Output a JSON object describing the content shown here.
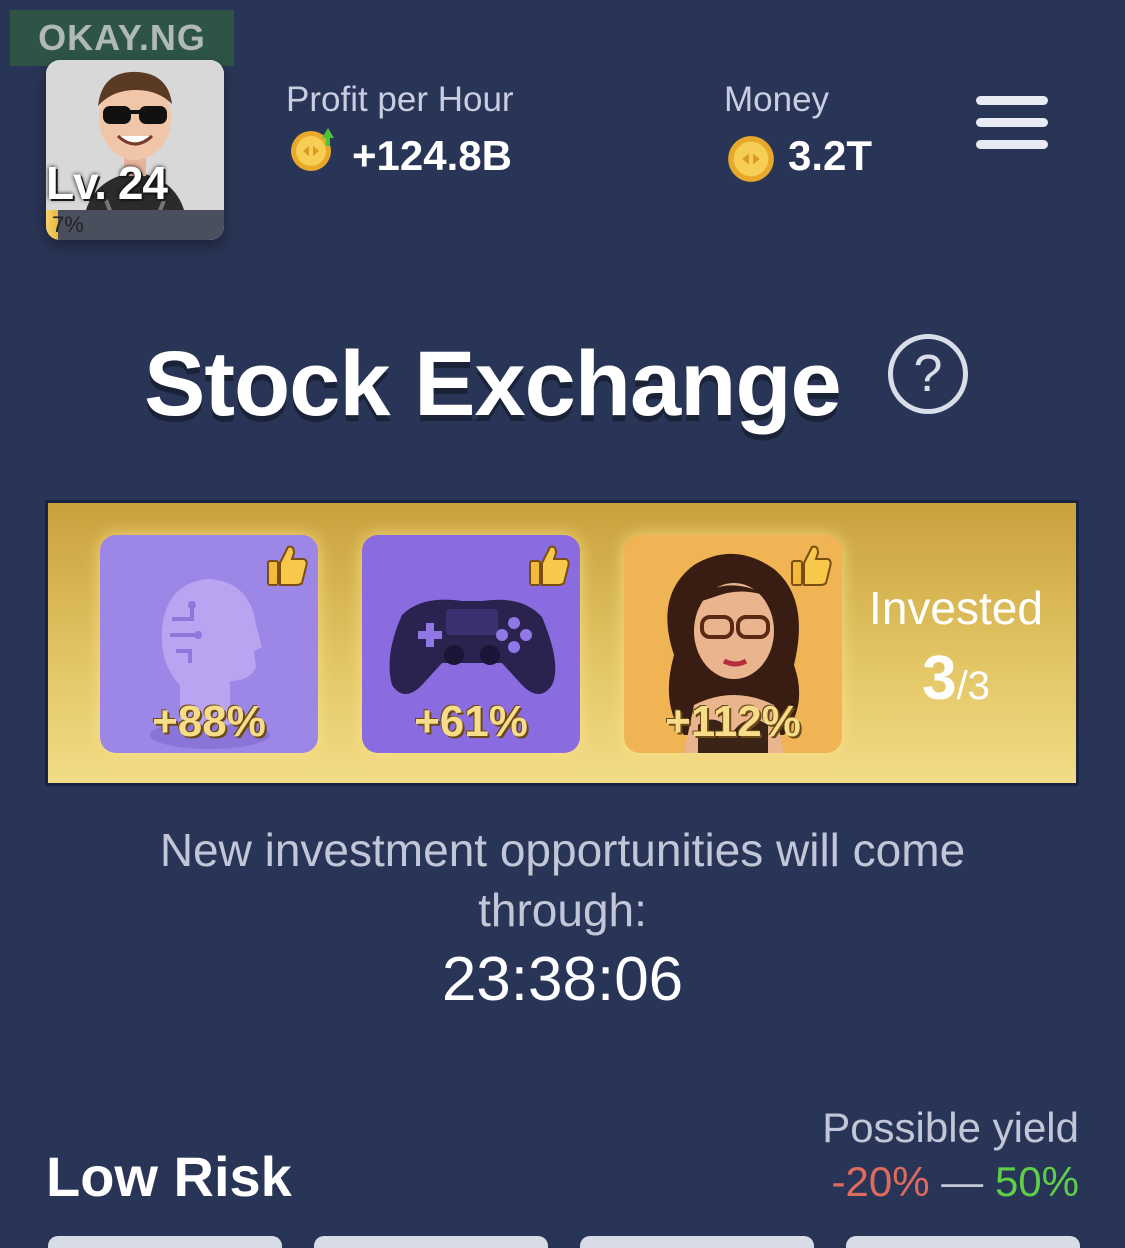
{
  "watermark": "OKAY.NG",
  "player": {
    "level": "Lv. 24",
    "level_progress": "7%",
    "level_progress_fraction": 0.07
  },
  "stats": {
    "profit_label": "Profit per Hour",
    "profit_value": "+124.8B",
    "money_label": "Money",
    "money_value": "3.2T"
  },
  "page": {
    "title": "Stock Exchange",
    "help": "?"
  },
  "investments": {
    "cards": [
      {
        "name": "AI head",
        "yield": "+88%"
      },
      {
        "name": "Gamepad",
        "yield": "+61%"
      },
      {
        "name": "Pin-up girl",
        "yield": "+112%"
      }
    ],
    "invested_label": "Invested",
    "invested_count": "3",
    "invested_total": "/3"
  },
  "info": {
    "message": "New investment opportunities will come through:",
    "countdown": "23:38:06"
  },
  "section": {
    "title": "Low Risk",
    "yield_label": "Possible yield",
    "yield_min": "-20%",
    "yield_separator": " — ",
    "yield_max": "50%"
  },
  "colors": {
    "background": "#293556",
    "gold": "#e2c463",
    "negative": "#e06a5e",
    "positive": "#5fcf4a"
  },
  "icons": {
    "coin": "coin-icon",
    "coin_up": "coin-up-icon",
    "menu": "hamburger-icon",
    "help": "question-circle-icon",
    "thumb": "thumbs-up-icon"
  }
}
